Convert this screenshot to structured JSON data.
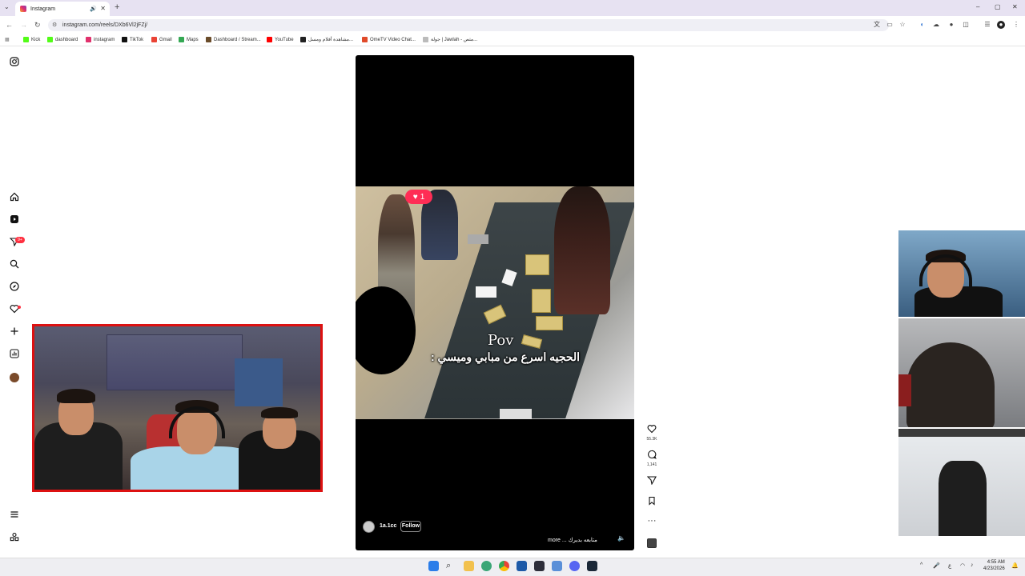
{
  "browser": {
    "tab_title": "Instagram",
    "url": "instagram.com/reels/DXb6Vl2jFZj/",
    "bookmarks": [
      {
        "label": "Kick",
        "color": "#53fc18"
      },
      {
        "label": "dashboard",
        "color": "#53fc18"
      },
      {
        "label": "instagram",
        "color": "#e1306c"
      },
      {
        "label": "TikTok",
        "color": "#111111"
      },
      {
        "label": "Gmail",
        "color": "#ea4335"
      },
      {
        "label": "Maps",
        "color": "#34a853"
      },
      {
        "label": "Dashboard / Stream...",
        "color": "#6a4c2a"
      },
      {
        "label": "YouTube",
        "color": "#ff0000"
      },
      {
        "label": "مشاهدة أفلام ومسل...",
        "color": "#222222"
      },
      {
        "label": "OmeTV Video Chat...",
        "color": "#e04a2a"
      },
      {
        "label": "جولة | Jawlah - مثص...",
        "color": "#bbbbbb"
      }
    ]
  },
  "reel": {
    "like_sticker_count": "1",
    "overlay_title": "Pov",
    "overlay_caption": "الحجيه اسرع من مبابي وميسي :",
    "owner": "1a.1cc",
    "follow_label": "Follow",
    "caption": "more ... متابعه بديرك",
    "likes": "55.3K",
    "comments": "1,141"
  },
  "icons": {
    "home": "home-icon",
    "reels": "reels-icon",
    "messages": "paper-plane-icon",
    "search": "search-icon",
    "explore": "compass-icon",
    "notifications": "heart-icon",
    "create": "plus-icon",
    "dashboard": "chart-icon"
  },
  "notifications_badge": "9+",
  "system": {
    "time": "4:55 AM",
    "date": "4/23/2026",
    "lang": "ع"
  },
  "colors": {
    "tabbar": "#e7e2f2",
    "accent_red": "#ff3040",
    "cam_border": "#dd1111"
  }
}
